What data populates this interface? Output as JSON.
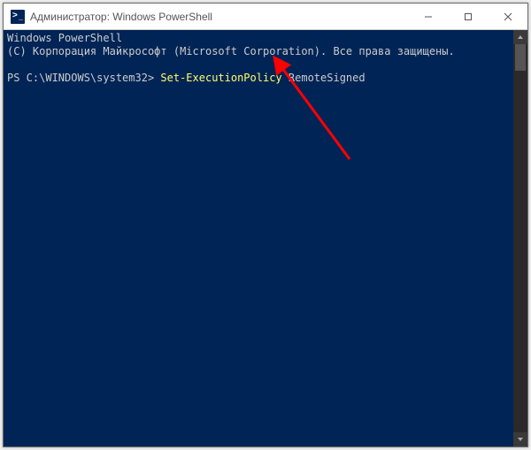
{
  "titlebar": {
    "title": "Администратор: Windows PowerShell"
  },
  "terminal": {
    "header_line1": "Windows PowerShell",
    "header_line2": "(C) Корпорация Майкрософт (Microsoft Corporation). Все права защищены.",
    "prompt": "PS C:\\WINDOWS\\system32> ",
    "command_cmdlet": "Set-ExecutionPolicy",
    "command_arg": " RemoteSigned"
  },
  "colors": {
    "terminal_bg": "#012456",
    "terminal_fg": "#cccccc",
    "cmdlet_fg": "#ffff66",
    "arrow": "#ff0000"
  }
}
